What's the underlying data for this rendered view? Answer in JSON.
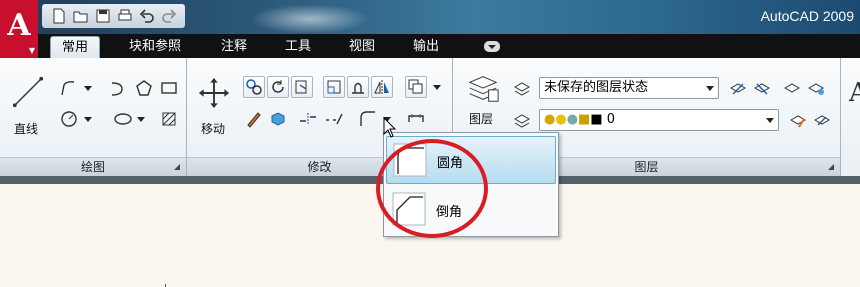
{
  "window": {
    "title": "AutoCAD 2009",
    "logo": "A"
  },
  "quick_access": [
    "new-icon",
    "open-icon",
    "save-icon",
    "print-icon",
    "undo-icon",
    "redo-icon"
  ],
  "tabs": [
    {
      "label": "常用",
      "active": true
    },
    {
      "label": "块和参照"
    },
    {
      "label": "注释"
    },
    {
      "label": "工具"
    },
    {
      "label": "视图"
    },
    {
      "label": "输出"
    }
  ],
  "panels": {
    "draw": {
      "title": "绘图",
      "line_label": "直线"
    },
    "modify": {
      "title": "修改",
      "move_label": "移动"
    },
    "layers": {
      "title": "图层",
      "layer_label": "图层",
      "layer_state": "未保存的图层状态",
      "current_layer": "0"
    }
  },
  "flyout": {
    "items": [
      {
        "label": "圆角",
        "icon": "fillet-icon",
        "highlighted": true
      },
      {
        "label": "倒角",
        "icon": "chamfer-icon"
      }
    ]
  },
  "colors": {
    "accent_red": "#d81e25",
    "logo_red": "#c8102e",
    "tab_bar": "#111111"
  }
}
